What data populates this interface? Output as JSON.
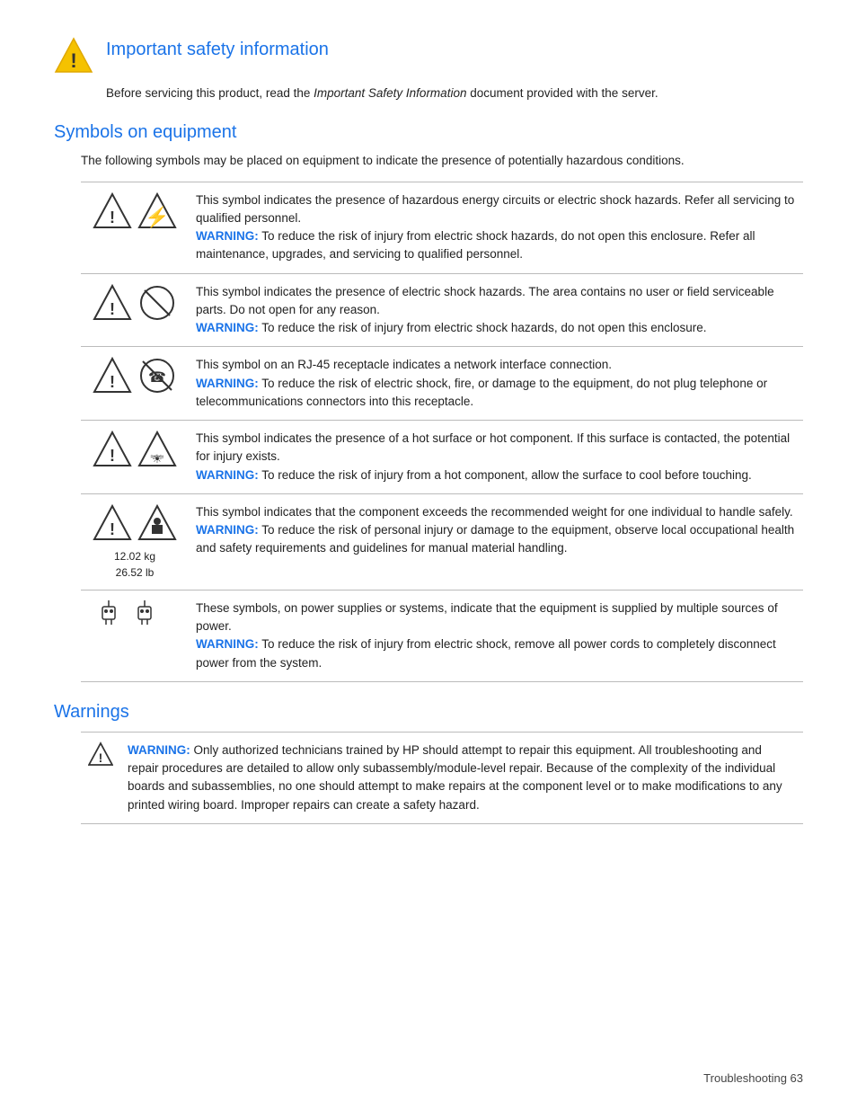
{
  "page": {
    "footer": "Troubleshooting    63"
  },
  "important_safety": {
    "title": "Important safety information",
    "body": "Before servicing this product, read the ",
    "body_italic": "Important Safety Information",
    "body_end": " document provided with the server."
  },
  "symbols_section": {
    "title": "Symbols on equipment",
    "intro": "The following symbols may be placed on equipment to indicate the presence of potentially hazardous conditions.",
    "rows": [
      {
        "description": "This symbol indicates the presence of hazardous energy circuits or electric shock hazards. Refer all servicing to qualified personnel.",
        "warning_label": "WARNING:",
        "warning_text": "  To reduce the risk of injury from electric shock hazards, do not open this enclosure. Refer all maintenance, upgrades, and servicing to qualified personnel.",
        "symbol_type": "hazardous_energy"
      },
      {
        "description": "This symbol indicates the presence of electric shock hazards. The area contains no user or field serviceable parts. Do not open for any reason.",
        "warning_label": "WARNING:",
        "warning_text": "  To reduce the risk of injury from electric shock hazards, do not open this enclosure.",
        "symbol_type": "electric_shock"
      },
      {
        "description": "This symbol on an RJ-45 receptacle indicates a network interface connection.",
        "warning_label": "WARNING:",
        "warning_text": "  To reduce the risk of electric shock, fire, or damage to the equipment, do not plug telephone or telecommunications connectors into this receptacle.",
        "symbol_type": "network"
      },
      {
        "description": "This symbol indicates the presence of a hot surface or hot component. If this surface is contacted, the potential for injury exists.",
        "warning_label": "WARNING:",
        "warning_text": "  To reduce the risk of injury from a hot component, allow the surface to cool before touching.",
        "symbol_type": "hot_surface"
      },
      {
        "description": "This symbol indicates that the component exceeds the recommended weight for one individual to handle safely.",
        "warning_label": "WARNING:",
        "warning_text": "  To reduce the risk of personal injury or damage to the equipment, observe local occupational health and safety requirements and guidelines for manual material handling.",
        "weight1": "12.02 kg",
        "weight2": "26.52 lb",
        "symbol_type": "heavy_weight"
      },
      {
        "description": " These symbols, on power supplies or systems, indicate that the equipment is supplied by multiple sources of power.",
        "warning_label": "WARNING:",
        "warning_text": "  To reduce the risk of injury from electric shock, remove all power cords to completely disconnect power from the system.",
        "symbol_type": "multiple_power"
      }
    ]
  },
  "warnings_section": {
    "title": "Warnings",
    "rows": [
      {
        "warning_label": "WARNING:",
        "warning_text": "  Only authorized technicians trained by HP should attempt to repair this equipment. All troubleshooting and repair procedures are detailed to allow only subassembly/module-level repair. Because of the complexity of the individual boards and subassemblies, no one should attempt to make repairs at the component level or to make modifications to any printed wiring board. Improper repairs can create a safety hazard."
      }
    ]
  }
}
